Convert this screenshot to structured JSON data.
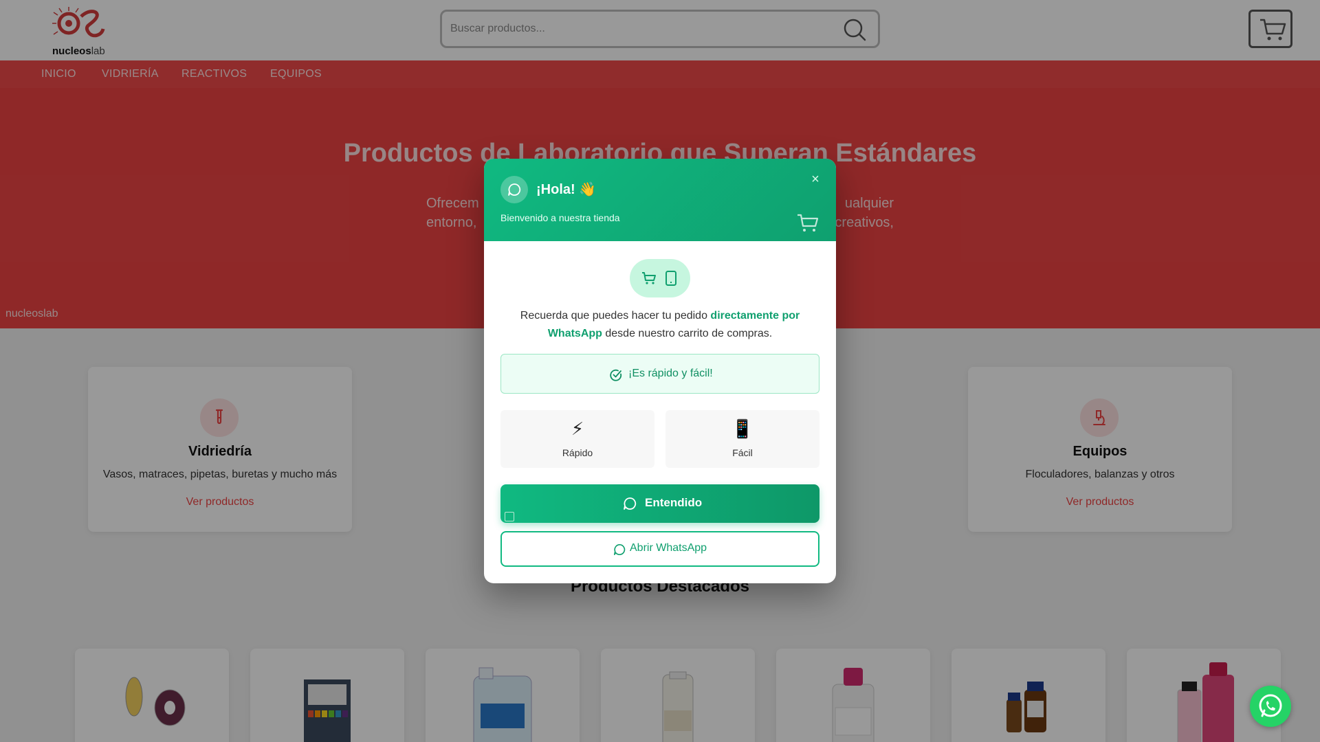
{
  "header": {
    "logo_bold": "nucleos",
    "logo_light": "lab",
    "search_placeholder": "Buscar productos..."
  },
  "nav": {
    "items": [
      {
        "label": "INICIO"
      },
      {
        "label": "VIDRIERÍA"
      },
      {
        "label": "REACTIVOS"
      },
      {
        "label": "EQUIPOS"
      }
    ]
  },
  "hero": {
    "title": "Productos de Laboratorio que Superan Estándares",
    "subtitle_left_1": "Ofrecem",
    "subtitle_right_1": "ualquier",
    "subtitle_left_2": "entorno,",
    "subtitle_right_2": "creativos,",
    "brand_watermark": "nucleoslab"
  },
  "categories": [
    {
      "title": "Vidriedría",
      "desc": "Vasos, matraces, pipetas, buretas y mucho más",
      "link": "Ver productos",
      "icon": "test-tube-icon"
    },
    {
      "title": "Equipos",
      "desc": "Floculadores, balanzas y otros",
      "link": "Ver productos",
      "icon": "microscope-icon"
    }
  ],
  "featured_title": "Productos Destacados",
  "modal": {
    "title": "¡Hola! 👋",
    "subtitle": "Bienvenido a nuestra tienda",
    "close_label": "×",
    "msg_before": "Recuerda que puedes hacer tu pedido ",
    "msg_highlight": "directamente por WhatsApp",
    "msg_after": " desde nuestro carrito de compras.",
    "quick_text": "¡Es rápido y fácil!",
    "features": [
      {
        "icon": "⚡",
        "label": "Rápido"
      },
      {
        "icon": "📱",
        "label": "Fácil"
      }
    ],
    "primary_button": "Entendido",
    "secondary_button": "Abrir WhatsApp"
  },
  "colors": {
    "brand_red": "#ef4444",
    "whatsapp_green": "#10b981"
  }
}
